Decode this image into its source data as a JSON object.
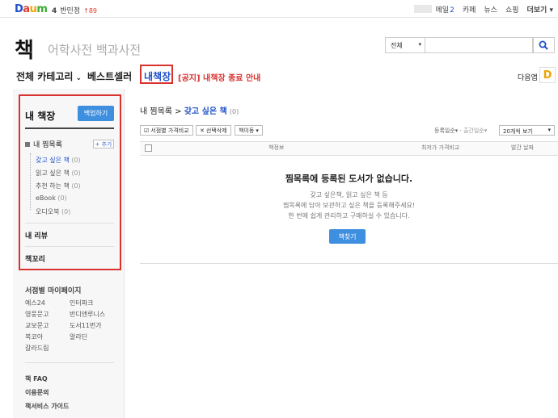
{
  "topbar": {
    "logo": {
      "d": "D",
      "a": "a",
      "u": "u",
      "m": "m"
    },
    "rank_num": "4",
    "rank_text": "반민정",
    "rank_change": "↑89",
    "links": [
      {
        "label": "메일",
        "count": "2"
      },
      {
        "label": "카페"
      },
      {
        "label": "뉴스"
      },
      {
        "label": "쇼핑"
      },
      {
        "label": "더보기"
      }
    ]
  },
  "header": {
    "title": "책",
    "dict_links": "어학사전 백과사전",
    "search": {
      "category": "전체",
      "value": ""
    }
  },
  "gnb": {
    "categories": "전체 카테고리",
    "bestseller": "베스트셀러",
    "my_books": "내책장",
    "notice": "[공지] 내책장 종료 안내",
    "daum_app": "다음앱",
    "daum_icon": "D"
  },
  "sidebar": {
    "title": "내 책장",
    "backup_button": "백업하기",
    "wishlist_title": "내 찜목록",
    "add_button": "+ 추가",
    "items": [
      {
        "label": "갖고 싶은 책",
        "count": "(0)"
      },
      {
        "label": "읽고 싶은 책",
        "count": "(0)"
      },
      {
        "label": "추천 하는 책",
        "count": "(0)"
      },
      {
        "label": "eBook",
        "count": "(0)"
      },
      {
        "label": "오디오북",
        "count": "(0)"
      }
    ],
    "my_review": "내 리뷰",
    "bookori": "책꼬리",
    "stores_title": "서점별 마이페이지",
    "stores": [
      [
        "예스24",
        "인터파크"
      ],
      [
        "영풍문고",
        "반디앤루니스"
      ],
      [
        "교보문고",
        "도서11번가"
      ],
      [
        "북코아",
        "알라딘"
      ],
      [
        "갈라드림",
        ""
      ]
    ],
    "faq": "책 FAQ",
    "inquiry": "이용문의",
    "guide": "책서비스 가이드"
  },
  "main": {
    "breadcrumb_parent": "내 찜목록",
    "breadcrumb_current": "갖고 싶은 책",
    "breadcrumb_count": "(0)",
    "toolbar": {
      "compare": "서점별 가격비교",
      "delete": "선택삭제",
      "move": "책이동"
    },
    "sort": {
      "registered": "등록일순",
      "published": "출간일순"
    },
    "view_select": "20개씩 보기",
    "columns": {
      "info": "책정보",
      "price": "최저가 가격비교",
      "date": "발간 날짜"
    },
    "empty_title": "찜목록에 등록된 도서가 없습니다.",
    "empty_lines": [
      "갖고 싶은책, 읽고 싶은 책 등",
      "찜목록에 담아 보관하고 싶은 책을 등록해주세요!",
      "한 번에 쉽게 관리하고 구매하실 수 있습니다."
    ],
    "find_button": "책찾기"
  }
}
